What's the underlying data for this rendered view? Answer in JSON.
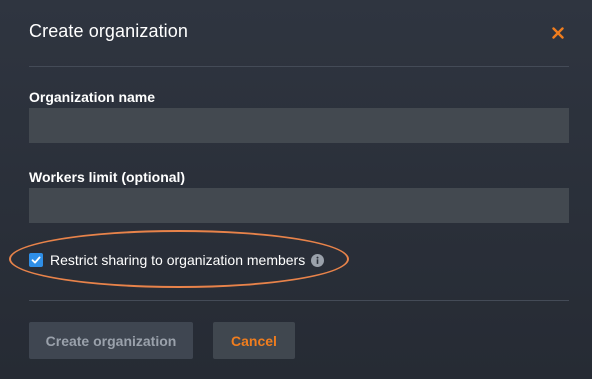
{
  "dialog": {
    "title": "Create organization",
    "close_icon": "close-x-icon"
  },
  "form": {
    "org_name_label": "Organization name",
    "org_name_value": "",
    "org_name_placeholder": "",
    "workers_label": "Workers limit (optional)",
    "workers_value": "",
    "workers_placeholder": "",
    "restrict_sharing_label": "Restrict sharing to organization members",
    "restrict_sharing_checked": true,
    "info_icon": "info-icon"
  },
  "footer": {
    "create_label": "Create organization",
    "create_enabled": false,
    "cancel_label": "Cancel"
  },
  "colors": {
    "accent": "#f07d1e",
    "checkbox": "#2f8fe8",
    "annotation": "#e8834a",
    "background": "#2b313b"
  }
}
